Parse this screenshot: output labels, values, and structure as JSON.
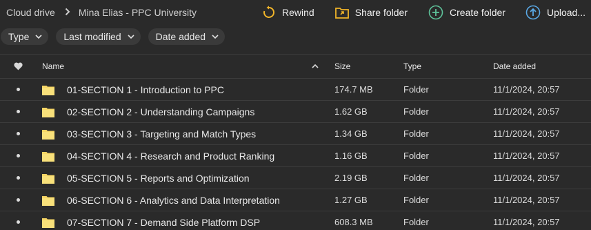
{
  "breadcrumb": {
    "root": "Cloud drive",
    "current": "Mina Elias - PPC University"
  },
  "actions": {
    "rewind": "Rewind",
    "share_folder": "Share folder",
    "create_folder": "Create folder",
    "upload": "Upload..."
  },
  "colors": {
    "rewind": "#f0b429",
    "share": "#f0b429",
    "create": "#5ec29a",
    "upload": "#5aa9e6",
    "folder": "#f5d565"
  },
  "filters": [
    "Type",
    "Last modified",
    "Date added"
  ],
  "columns": {
    "name": "Name",
    "size": "Size",
    "type": "Type",
    "date_added": "Date added"
  },
  "rows": [
    {
      "name": "01-SECTION 1 - Introduction to PPC",
      "size": "174.7 MB",
      "type": "Folder",
      "date": "11/1/2024, 20:57"
    },
    {
      "name": "02-SECTION 2 - Understanding Campaigns",
      "size": "1.62 GB",
      "type": "Folder",
      "date": "11/1/2024, 20:57"
    },
    {
      "name": "03-SECTION 3 - Targeting and Match Types",
      "size": "1.34 GB",
      "type": "Folder",
      "date": "11/1/2024, 20:57"
    },
    {
      "name": "04-SECTION 4 - Research and Product Ranking",
      "size": "1.16 GB",
      "type": "Folder",
      "date": "11/1/2024, 20:57"
    },
    {
      "name": "05-SECTION 5 - Reports and Optimization",
      "size": "2.19 GB",
      "type": "Folder",
      "date": "11/1/2024, 20:57"
    },
    {
      "name": "06-SECTION 6 - Analytics and Data Interpretation",
      "size": "1.27 GB",
      "type": "Folder",
      "date": "11/1/2024, 20:57"
    },
    {
      "name": "07-SECTION 7 - Demand Side Platform DSP",
      "size": "608.3 MB",
      "type": "Folder",
      "date": "11/1/2024, 20:57"
    }
  ]
}
